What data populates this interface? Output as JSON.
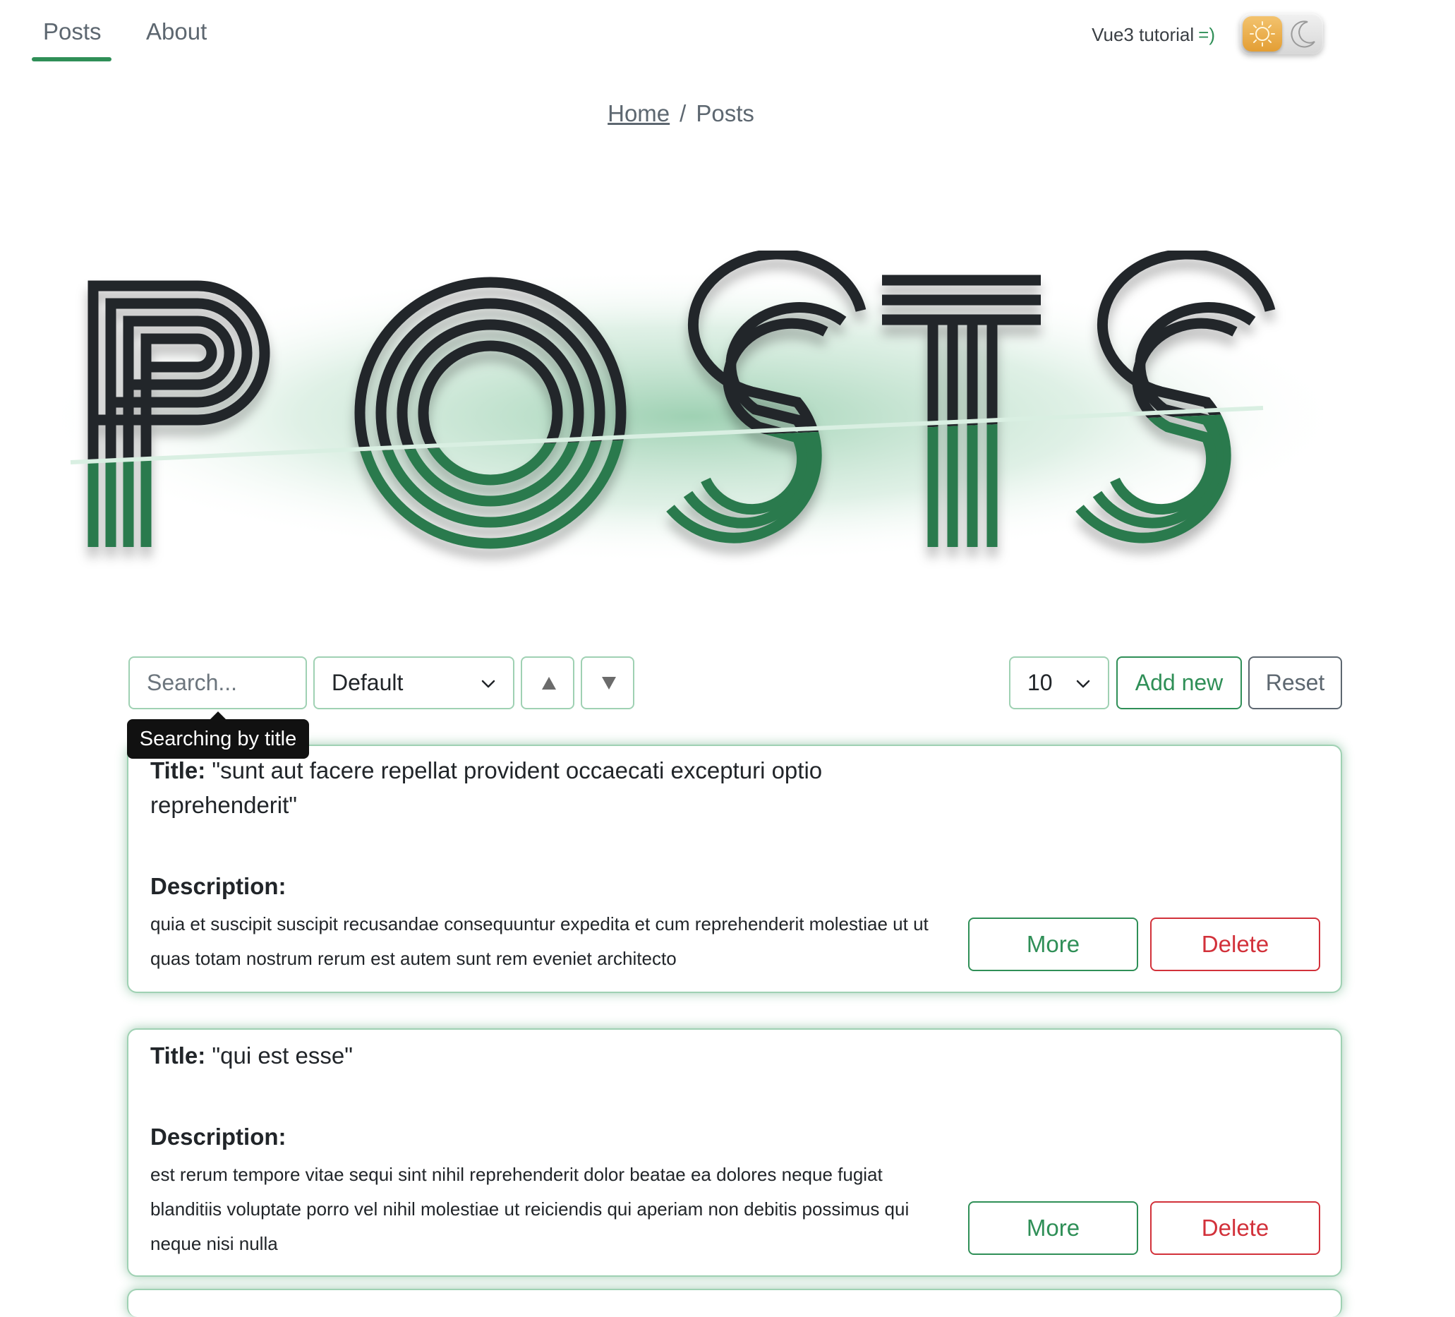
{
  "nav": {
    "tabs": [
      {
        "label": "Posts",
        "active": true
      },
      {
        "label": "About",
        "active": false
      }
    ],
    "brand_text": "Vue3 tutorial",
    "brand_smile": "=)",
    "theme_toggle": {
      "state": "light",
      "sun_icon": "sun-icon",
      "moon_icon": "moon-icon"
    }
  },
  "breadcrumb": {
    "home": "Home",
    "separator": "/",
    "current": "Posts"
  },
  "hero": {
    "word": "POSTS"
  },
  "toolbar": {
    "search_placeholder": "Search...",
    "search_tooltip": "Searching by title",
    "sort_value": "Default",
    "sort_up_icon": "triangle-up-icon",
    "sort_down_icon": "triangle-down-icon",
    "limit_value": "10",
    "add_label": "Add new",
    "reset_label": "Reset"
  },
  "posts": [
    {
      "title_label": "Title:",
      "title": "\"sunt aut facere repellat provident occaecati excepturi optio reprehenderit\"",
      "desc_label": "Description:",
      "description": "quia et suscipit suscipit recusandae consequuntur expedita et cum reprehenderit molestiae ut ut quas totam nostrum rerum est autem sunt rem eveniet architecto",
      "more_label": "More",
      "delete_label": "Delete"
    },
    {
      "title_label": "Title:",
      "title": "\"qui est esse\"",
      "desc_label": "Description:",
      "description": "est rerum tempore vitae sequi sint nihil reprehenderit dolor beatae ea dolores neque fugiat blanditiis voluptate porro vel nihil molestiae ut reiciendis qui aperiam non debitis possimus qui neque nisi nulla",
      "more_label": "More",
      "delete_label": "Delete"
    }
  ],
  "colors": {
    "accent": "#2f8f57",
    "accent_light": "#9fd1b3",
    "danger": "#d2313a",
    "muted": "#5d6770",
    "text": "#212529"
  }
}
